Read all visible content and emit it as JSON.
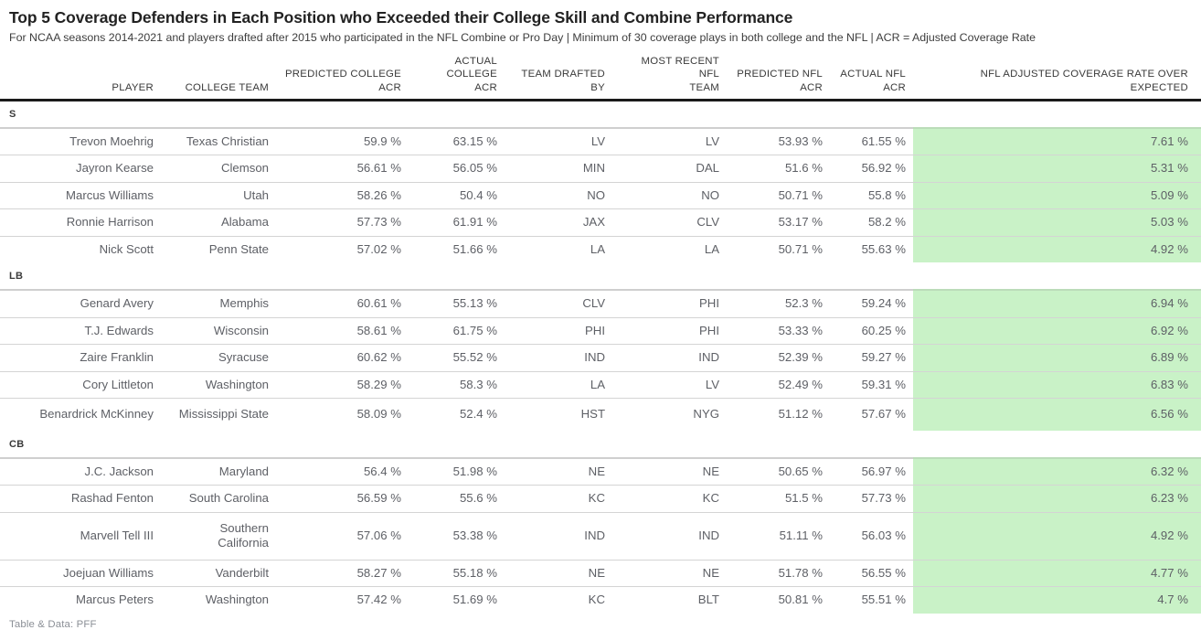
{
  "header": {
    "title": "Top 5 Coverage Defenders in Each Position who Exceeded their College Skill and Combine Performance",
    "subtitle": "For NCAA seasons 2014-2021 and players drafted after 2015 who participated in the NFL Combine or Pro Day | Minimum of 30 coverage plays in both college and the NFL | ACR = Adjusted Coverage Rate"
  },
  "table": {
    "columns": [
      {
        "key": "player",
        "label": "PLAYER"
      },
      {
        "key": "college",
        "label": "COLLEGE TEAM"
      },
      {
        "key": "pred_col",
        "label": "PREDICTED COLLEGE ACR"
      },
      {
        "key": "act_col",
        "label": "ACTUAL COLLEGE ACR"
      },
      {
        "key": "drafted",
        "label": "TEAM DRAFTED BY"
      },
      {
        "key": "recent",
        "label": "MOST RECENT NFL TEAM"
      },
      {
        "key": "pred_nfl",
        "label": "PREDICTED NFL ACR"
      },
      {
        "key": "act_nfl",
        "label": "ACTUAL NFL ACR"
      },
      {
        "key": "over_exp",
        "label": "NFL ADJUSTED COVERAGE RATE OVER EXPECTED"
      }
    ],
    "column_labels_wrapped": {
      "player": [
        "",
        "PLAYER"
      ],
      "college": [
        "",
        "COLLEGE TEAM"
      ],
      "pred_col": [
        "PREDICTED COLLEGE",
        "ACR"
      ],
      "act_col": [
        "ACTUAL COLLEGE",
        "ACR"
      ],
      "drafted": [
        "TEAM DRAFTED",
        "BY"
      ],
      "recent": [
        "MOST RECENT NFL",
        "TEAM"
      ],
      "pred_nfl": [
        "PREDICTED NFL",
        "ACR"
      ],
      "act_nfl": [
        "ACTUAL NFL",
        "ACR"
      ],
      "over_exp": [
        "NFL ADJUSTED COVERAGE RATE OVER",
        "EXPECTED"
      ]
    },
    "highlight_color": "#c9f2c7",
    "groups": [
      {
        "label": "S",
        "rows": [
          {
            "player": "Trevon Moehrig",
            "college": "Texas Christian",
            "pred_col": "59.9 %",
            "act_col": "63.15 %",
            "drafted": "LV",
            "recent": "LV",
            "pred_nfl": "53.93 %",
            "act_nfl": "61.55 %",
            "over_exp": "7.61 %"
          },
          {
            "player": "Jayron Kearse",
            "college": "Clemson",
            "pred_col": "56.61 %",
            "act_col": "56.05 %",
            "drafted": "MIN",
            "recent": "DAL",
            "pred_nfl": "51.6 %",
            "act_nfl": "56.92 %",
            "over_exp": "5.31 %"
          },
          {
            "player": "Marcus Williams",
            "college": "Utah",
            "pred_col": "58.26 %",
            "act_col": "50.4 %",
            "drafted": "NO",
            "recent": "NO",
            "pred_nfl": "50.71 %",
            "act_nfl": "55.8 %",
            "over_exp": "5.09 %"
          },
          {
            "player": "Ronnie Harrison",
            "college": "Alabama",
            "pred_col": "57.73 %",
            "act_col": "61.91 %",
            "drafted": "JAX",
            "recent": "CLV",
            "pred_nfl": "53.17 %",
            "act_nfl": "58.2 %",
            "over_exp": "5.03 %"
          },
          {
            "player": "Nick Scott",
            "college": "Penn State",
            "pred_col": "57.02 %",
            "act_col": "51.66 %",
            "drafted": "LA",
            "recent": "LA",
            "pred_nfl": "50.71 %",
            "act_nfl": "55.63 %",
            "over_exp": "4.92 %"
          }
        ]
      },
      {
        "label": "LB",
        "rows": [
          {
            "player": "Genard Avery",
            "college": "Memphis",
            "pred_col": "60.61 %",
            "act_col": "55.13 %",
            "drafted": "CLV",
            "recent": "PHI",
            "pred_nfl": "52.3 %",
            "act_nfl": "59.24 %",
            "over_exp": "6.94 %"
          },
          {
            "player": "T.J. Edwards",
            "college": "Wisconsin",
            "pred_col": "58.61 %",
            "act_col": "61.75 %",
            "drafted": "PHI",
            "recent": "PHI",
            "pred_nfl": "53.33 %",
            "act_nfl": "60.25 %",
            "over_exp": "6.92 %"
          },
          {
            "player": "Zaire Franklin",
            "college": "Syracuse",
            "pred_col": "60.62 %",
            "act_col": "55.52 %",
            "drafted": "IND",
            "recent": "IND",
            "pred_nfl": "52.39 %",
            "act_nfl": "59.27 %",
            "over_exp": "6.89 %"
          },
          {
            "player": "Cory Littleton",
            "college": "Washington",
            "pred_col": "58.29 %",
            "act_col": "58.3 %",
            "drafted": "LA",
            "recent": "LV",
            "pred_nfl": "52.49 %",
            "act_nfl": "59.31 %",
            "over_exp": "6.83 %"
          },
          {
            "player": "Benardrick McKinney",
            "college": "Mississippi State",
            "pred_col": "58.09 %",
            "act_col": "52.4 %",
            "drafted": "HST",
            "recent": "NYG",
            "pred_nfl": "51.12 %",
            "act_nfl": "57.67 %",
            "over_exp": "6.56 %",
            "tall": true
          }
        ]
      },
      {
        "label": "CB",
        "rows": [
          {
            "player": "J.C. Jackson",
            "college": "Maryland",
            "pred_col": "56.4 %",
            "act_col": "51.98 %",
            "drafted": "NE",
            "recent": "NE",
            "pred_nfl": "50.65 %",
            "act_nfl": "56.97 %",
            "over_exp": "6.32 %"
          },
          {
            "player": "Rashad Fenton",
            "college": "South Carolina",
            "pred_col": "56.59 %",
            "act_col": "55.6 %",
            "drafted": "KC",
            "recent": "KC",
            "pred_nfl": "51.5 %",
            "act_nfl": "57.73 %",
            "over_exp": "6.23 %"
          },
          {
            "player": "Marvell Tell III",
            "college": "Southern California",
            "pred_col": "57.06 %",
            "act_col": "53.38 %",
            "drafted": "IND",
            "recent": "IND",
            "pred_nfl": "51.11 %",
            "act_nfl": "56.03 %",
            "over_exp": "4.92 %",
            "tall": true
          },
          {
            "player": "Joejuan Williams",
            "college": "Vanderbilt",
            "pred_col": "58.27 %",
            "act_col": "55.18 %",
            "drafted": "NE",
            "recent": "NE",
            "pred_nfl": "51.78 %",
            "act_nfl": "56.55 %",
            "over_exp": "4.77 %"
          },
          {
            "player": "Marcus Peters",
            "college": "Washington",
            "pred_col": "57.42 %",
            "act_col": "51.69 %",
            "drafted": "KC",
            "recent": "BLT",
            "pred_nfl": "50.81 %",
            "act_nfl": "55.51 %",
            "over_exp": "4.7 %"
          }
        ]
      }
    ]
  },
  "footer": {
    "source": "Table & Data: PFF"
  }
}
